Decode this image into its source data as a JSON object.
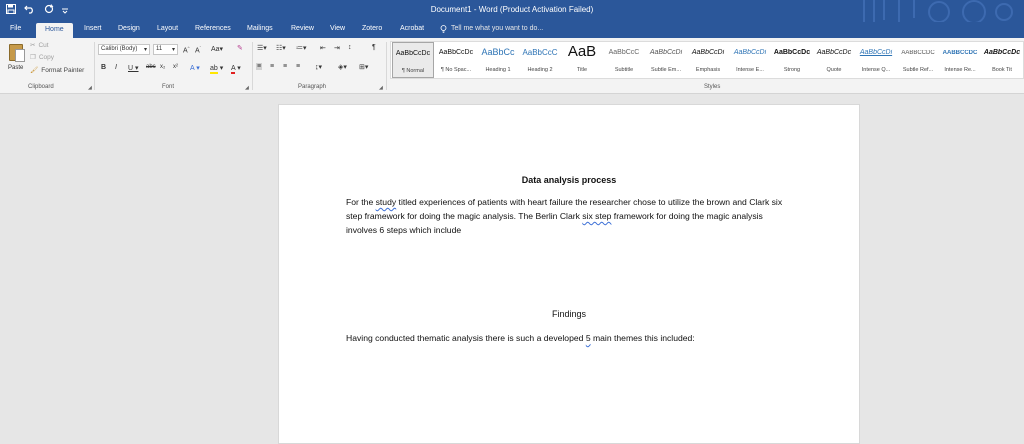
{
  "app": {
    "window_title": "Document1 - Word (Product Activation Failed)"
  },
  "qat": {
    "save_icon": "save-icon",
    "undo_icon": "undo-icon",
    "redo_icon": "redo-icon",
    "customize_icon": "customize-qat-icon"
  },
  "tabs": [
    {
      "label": "File"
    },
    {
      "label": "Home"
    },
    {
      "label": "Insert"
    },
    {
      "label": "Design"
    },
    {
      "label": "Layout"
    },
    {
      "label": "References"
    },
    {
      "label": "Mailings"
    },
    {
      "label": "Review"
    },
    {
      "label": "View"
    },
    {
      "label": "Zotero"
    },
    {
      "label": "Acrobat"
    }
  ],
  "tell_me": {
    "text": "Tell me what you want to do..."
  },
  "clipboard": {
    "paste": "Paste",
    "cut": "Cut",
    "copy": "Copy",
    "format_painter": "Format Painter",
    "group": "Clipboard"
  },
  "font": {
    "name": "Calibri (Body)",
    "size": "11",
    "group": "Font"
  },
  "paragraph": {
    "group": "Paragraph"
  },
  "styles": {
    "group": "Styles",
    "items": [
      {
        "preview": "AaBbCcDc",
        "name": "¶ Normal"
      },
      {
        "preview": "AaBbCcDc",
        "name": "¶ No Spac..."
      },
      {
        "preview": "AaBbCc",
        "name": "Heading 1"
      },
      {
        "preview": "AaBbCcC",
        "name": "Heading 2"
      },
      {
        "preview": "AaB",
        "name": "Title"
      },
      {
        "preview": "AaBbCcC",
        "name": "Subtitle"
      },
      {
        "preview": "AaBbCcDi",
        "name": "Subtle Em..."
      },
      {
        "preview": "AaBbCcDi",
        "name": "Emphasis"
      },
      {
        "preview": "AaBbCcDi",
        "name": "Intense E..."
      },
      {
        "preview": "AaBbCcDc",
        "name": "Strong"
      },
      {
        "preview": "AaBbCcDc",
        "name": "Quote"
      },
      {
        "preview": "AaBbCcDi",
        "name": "Intense Q..."
      },
      {
        "preview": "AABBCCDC",
        "name": "Subtle Ref..."
      },
      {
        "preview": "AABBCCDC",
        "name": "Intense Re..."
      },
      {
        "preview": "AaBbCcDc",
        "name": "Book Tit"
      }
    ]
  },
  "document": {
    "heading1": "Data analysis process",
    "para1": {
      "a": "For the ",
      "b": "study",
      "c": " titled experiences of patients with heart failure the researcher chose to utilize the brown and Clark six step framework for doing the magic analysis. The Berlin Clark ",
      "d": "six step",
      "e": " framework for doing the magic analysis involves 6 steps which include"
    },
    "heading2": "Findings",
    "para2": {
      "a": "Having conducted thematic analysis there is such a developed ",
      "b": "5",
      "c": " main themes this included:"
    }
  },
  "colors": {
    "title_bar": "#2b579a",
    "ribbon": "#f3f3f3",
    "page": "#ffffff",
    "workspace": "#e6e6e6"
  }
}
